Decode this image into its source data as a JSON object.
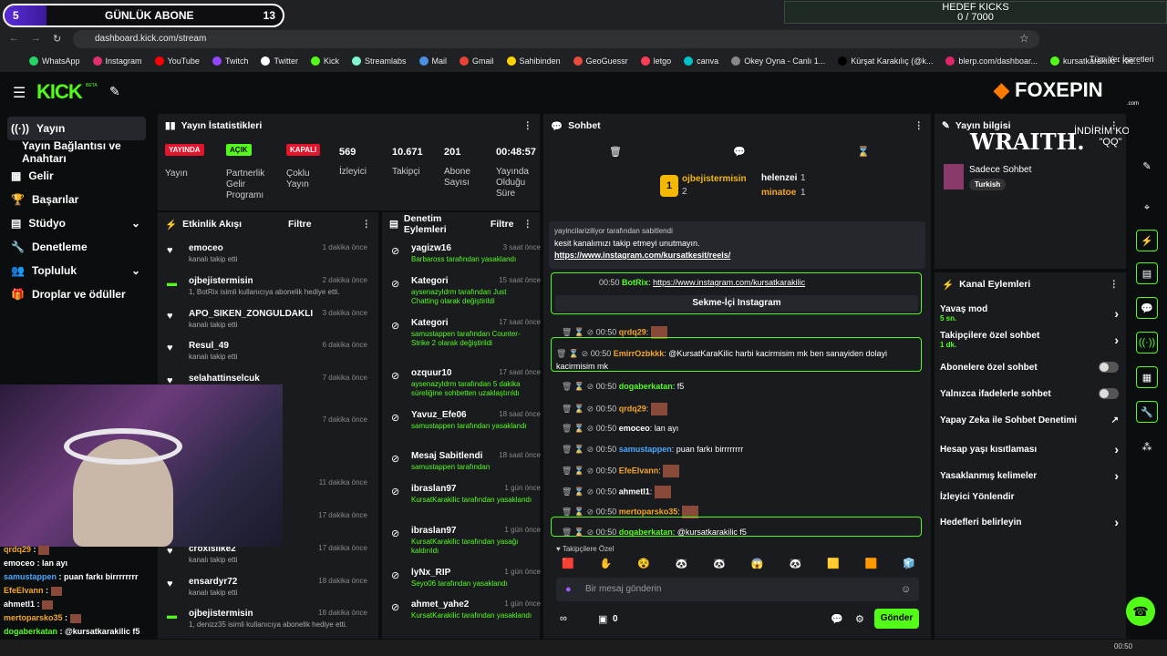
{
  "overlay": {
    "sub_goal_count": "5",
    "sub_goal_label": "GÜNLÜK ABONE",
    "sub_goal_target": "13",
    "kick_goal_title": "HEDEF KICKS",
    "kick_goal_value": "0 / 7000"
  },
  "browser": {
    "url": "dashboard.kick.com/stream",
    "other_bookmarks": "Tüm Yer İşaretleri",
    "bookmarks": [
      "WhatsApp",
      "Instagram",
      "YouTube",
      "Twitch",
      "Twitter",
      "Kick",
      "Streamlabs",
      "Mail",
      "Gmail",
      "Sahibinden",
      "GeoGuessr",
      "letgo",
      "canva",
      "Okey Oyna - Canlı 1...",
      "Kürşat Karakılıç (@k...",
      "blerp.com/dashboar...",
      "kursatkarakilic - Kic..."
    ]
  },
  "brand": {
    "logo": "KICK",
    "beta": "BETA",
    "sponsor": "FOXEPIN",
    "sponsor_sub": ".com"
  },
  "sidebar": {
    "items": [
      "Yayın",
      "Yayın Bağlantısı ve Anahtarı",
      "Gelir",
      "Başarılar",
      "Stüdyo",
      "Denetleme",
      "Topluluk",
      "Droplar ve ödüller"
    ]
  },
  "stats": {
    "title": "Yayın İstatistikleri",
    "live": "YAYINDA",
    "live_label": "Yayın",
    "partner": "AÇIK",
    "partner_label": "Partnerlik Gelir Programı",
    "multi": "KAPALI",
    "multi_label": "Çoklu Yayın",
    "viewers": "569",
    "viewers_label": "İzleyici",
    "followers": "10.671",
    "followers_label": "Takipçi",
    "subs": "201",
    "subs_label": "Abone Sayısı",
    "uptime": "00:48:57",
    "uptime_label": "Yayında Olduğu Süre"
  },
  "activity": {
    "title": "Etkinlik Akışı",
    "filter": "Filtre",
    "items": [
      {
        "name": "emoceo",
        "sub": "kanalı takip etti",
        "time": "1 dakika önce"
      },
      {
        "name": "ojbejistermisin",
        "sub": "1, BotRix isimli kullanıcıya abonelik hediye etti.",
        "time": "2 dakika önce"
      },
      {
        "name": "APO_SIKEN_ZONGULDAKLI",
        "sub": "kanalı takip etti",
        "time": "3 dakika önce"
      },
      {
        "name": "Resul_49",
        "sub": "kanalı takip etti",
        "time": "6 dakika önce"
      },
      {
        "name": "selahattinselcuk",
        "sub": "kullanıcıya abonelik hediye",
        "time": "7 dakika önce"
      },
      {
        "name": "",
        "sub": "r! Toplam abonelik",
        "time": "7 dakika önce"
      },
      {
        "name": "",
        "sub": "",
        "time": "11 dakika önce"
      },
      {
        "name": "",
        "sub": "",
        "time": "17 dakika önce"
      },
      {
        "name": "croxislike2",
        "sub": "kanalı takip etti",
        "time": "17 dakika önce"
      },
      {
        "name": "ensardyr72",
        "sub": "kanalı takip etti",
        "time": "18 dakika önce"
      },
      {
        "name": "ojbejistermisin",
        "sub": "1, denizz35 isimli kullanıcıya abonelik hediye etti.",
        "time": "18 dakika önce"
      }
    ]
  },
  "moderation": {
    "title": "Denetim Eylemleri",
    "filter": "Filtre",
    "items": [
      {
        "name": "yagizw16",
        "sub": "Barbaross tarafından yasaklandı",
        "time": "3 saat önce"
      },
      {
        "name": "Kategori",
        "sub": "aysenazyldrm tarafından Just Chatting olarak değiştirildi",
        "time": "15 saat önce"
      },
      {
        "name": "Kategori",
        "sub": "samustappen tarafından Counter-Strike 2 olarak değiştirildi",
        "time": "17 saat önce"
      },
      {
        "name": "ozquur10",
        "sub": "aysenazyldrm tarafından 5 dakika süreliğine sohbetten uzaklaştırıldı",
        "time": "17 saat önce"
      },
      {
        "name": "Yavuz_Efe06",
        "sub": "samustappen tarafından yasaklandı",
        "time": "18 saat önce"
      },
      {
        "name": "Mesaj Sabitlendi",
        "sub": "samustappen tarafından",
        "time": "18 saat önce"
      },
      {
        "name": "ibraslan97",
        "sub": "KursatKarakilic tarafından yasaklandı",
        "time": "1 gün önce"
      },
      {
        "name": "ibraslan97",
        "sub": "KursatKarakilic tarafından yasağı kaldırıldı",
        "time": "1 gün önce"
      },
      {
        "name": "lyNx_RIP",
        "sub": "Seyo06 tarafından yasaklandı",
        "time": "1 gün önce"
      },
      {
        "name": "ahmet_yahe2",
        "sub": "KursatKarakilic tarafından yasaklandı",
        "time": "1 gün önce"
      }
    ]
  },
  "chat": {
    "title": "Sohbet",
    "top1": "ojbejistermisin",
    "top1_count": "2",
    "top2": "helenzei",
    "top2_count": "1",
    "top3": "minatoe",
    "top3_count": "1",
    "pinned_by": "yayincilariziliyor tarafından sabitlendi",
    "pinned_text": "kesit kanalımızı takip etmeyi unutmayın.",
    "pinned_link": "https://www.instagram.com/kursatkesit/reels/",
    "botrix_user": "BotRix",
    "botrix_link": "https://www.instagram.com/kursatkarakilic",
    "botrix_button": "Sekme-İçi Instagram",
    "messages": [
      {
        "time": "00:50",
        "user": "qrdq29",
        "text": ""
      },
      {
        "time": "00:50",
        "user": "EmirrOzbkkk",
        "text": "@KursatKaraKilic harbi kacirmisim mk ben sanayiden dolayi kacirmisim mk"
      },
      {
        "time": "00:50",
        "user": "dogaberkatan",
        "text": "f5"
      },
      {
        "time": "00:50",
        "user": "qrdq29",
        "text": ""
      },
      {
        "time": "00:50",
        "user": "emoceo",
        "text": "lan ayı"
      },
      {
        "time": "00:50",
        "user": "samustappen",
        "text": "puan farkı birrrrrrrr"
      },
      {
        "time": "00:50",
        "user": "EfeElvann",
        "text": ""
      },
      {
        "time": "00:50",
        "user": "ahmetl1",
        "text": ""
      },
      {
        "time": "00:50",
        "user": "mertoparsko35",
        "text": ""
      },
      {
        "time": "00:50",
        "user": "dogaberkatan",
        "text": "@kursatkarakilic f5"
      }
    ],
    "followers_only": "Takipçilere Özel",
    "placeholder": "Bir mesaj gönderin",
    "points": "0",
    "send": "Gönder"
  },
  "stream_info": {
    "title": "Yayın bilgisi",
    "category": "Sadece Sohbet",
    "tag": "Turkish",
    "wraith": "WRAITH.",
    "promo": "İNDİRİM KODU: \"QQ\""
  },
  "channel_actions": {
    "title": "Kanal Eylemleri",
    "items": [
      {
        "label": "Yavaş mod",
        "sub": "5 sn."
      },
      {
        "label": "Takipçilere özel sohbet",
        "sub": "1 dk."
      },
      {
        "label": "Abonelere özel sohbet",
        "sub": ""
      },
      {
        "label": "Yalnızca ifadelerle sohbet",
        "sub": ""
      },
      {
        "label": "Yapay Zeka ile Sohbet Denetimi",
        "sub": ""
      },
      {
        "label": "Hesap yaşı kısıtlaması",
        "sub": ""
      },
      {
        "label": "Yasaklanmış kelimeler",
        "sub": ""
      },
      {
        "label": "İzleyici Yönlendir",
        "sub": ""
      },
      {
        "label": "Hedefleri belirleyin",
        "sub": ""
      }
    ]
  },
  "overlay_chat": [
    {
      "user": "qrdq29",
      "text": ""
    },
    {
      "user": "emoceo",
      "text": "lan ayı"
    },
    {
      "user": "samustappen",
      "text": "puan farkı birrrrrrrr"
    },
    {
      "user": "EfeElvann",
      "text": ""
    },
    {
      "user": "ahmetl1",
      "text": ""
    },
    {
      "user": "mertoparsko35",
      "text": ""
    },
    {
      "user": "dogaberkatan",
      "text": "@kursatkarakilic f5"
    }
  ],
  "taskbar": {
    "clock": "00:50"
  }
}
